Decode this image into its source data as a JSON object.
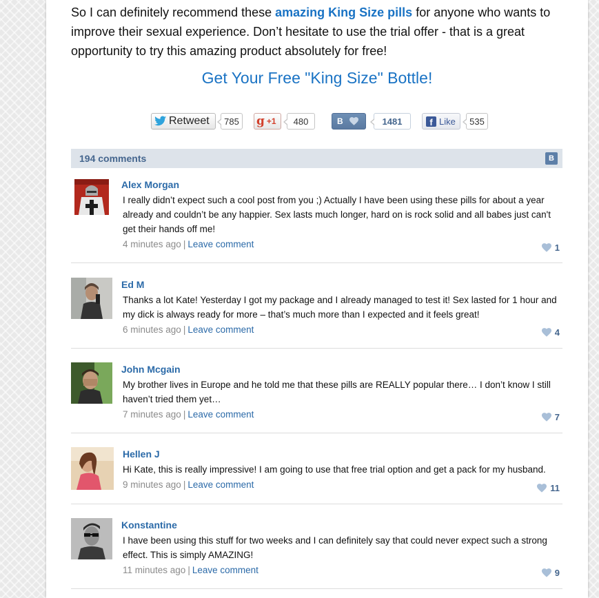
{
  "article": {
    "intro_before": "So I can definitely recommend these ",
    "intro_highlight": "amazing King Size pills",
    "intro_after": " for anyone who wants to improve their sexual experience. Don’t hesitate to use the trial offer - that is a great opportunity to try this amazing product absolutely for free!",
    "cta_link": "Get Your Free \"King Size\" Bottle!"
  },
  "share": {
    "retweet_label": "Retweet",
    "retweet_count": "785",
    "gplus_label": "+1",
    "gplus_count": "480",
    "vk_label": "B",
    "vk_count": "1481",
    "fb_label": "Like",
    "fb_count": "535"
  },
  "comments_header": {
    "count_label": "194 comments",
    "vk_badge": "B"
  },
  "comments": [
    {
      "author": "Alex Morgan",
      "text": "I really didn’t expect such a cool post from you ;) Actually I have been using these pills for about a year already and couldn’t be any happier. Sex lasts much longer, hard on is rock solid and all babes just can't get their hands off me!",
      "time": "4 minutes ago",
      "separator": "|",
      "leave": "Leave comment",
      "likes": "1"
    },
    {
      "author": "Ed M",
      "text": "Thanks a lot Kate! Yesterday I got my package and I already managed to test it! Sex lasted for 1 hour and my dick is always ready for more – that’s much more than I expected and it feels great!",
      "time": "6 minutes ago",
      "separator": "|",
      "leave": "Leave comment",
      "likes": "4"
    },
    {
      "author": "John Mcgain",
      "text": "My brother lives in Europe and he told me that these pills are REALLY popular there… I don’t know I still haven’t tried them yet…",
      "time": "7 minutes ago",
      "separator": "|",
      "leave": "Leave comment",
      "likes": "7"
    },
    {
      "author": "Hellen J",
      "text": "Hi Kate, this is really impressive! I am going to use that free trial option and get a pack for my husband.",
      "time": "9 minutes ago",
      "separator": "|",
      "leave": "Leave comment",
      "likes": "11"
    },
    {
      "author": "Konstantine",
      "text": "I have been using this stuff for two weeks and I can definitely say that could never expect such a strong effect. This is simply AMAZING!",
      "time": "11 minutes ago",
      "separator": "|",
      "leave": "Leave comment",
      "likes": "9"
    }
  ],
  "icons": {
    "twitter": "twitter-bird-icon",
    "gplus": "google-plus-icon",
    "vk": "vk-icon",
    "heart": "heart-icon",
    "facebook": "facebook-icon"
  },
  "colors": {
    "link_blue": "#1a73c4",
    "comment_blue": "#2b6aa8",
    "vk_blue": "#45668e",
    "bar_bg": "#dde3ea"
  }
}
